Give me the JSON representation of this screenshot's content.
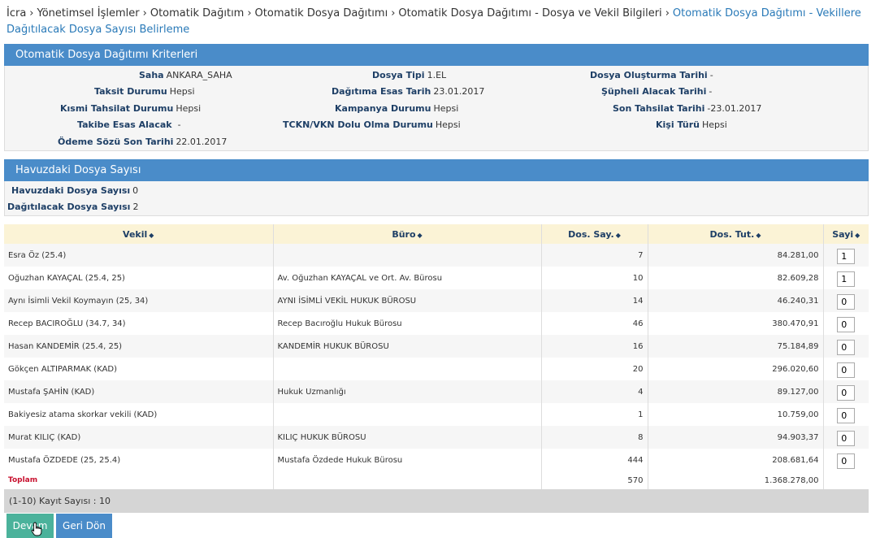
{
  "breadcrumb": {
    "items": [
      "İcra",
      "Yönetimsel İşlemler",
      "Otomatik Dağıtım",
      "Otomatik Dosya Dağıtımı",
      "Otomatik Dosya Dağıtımı - Dosya ve Vekil Bilgileri"
    ],
    "current": "Otomatik Dosya Dağıtımı - Vekillere Dağıtılacak Dosya Sayısı Belirleme",
    "separator": "›"
  },
  "criteria": {
    "title": "Otomatik Dosya Dağıtımı Kriterleri",
    "fields": {
      "saha": {
        "label": "Saha",
        "value": "ANKARA_SAHA"
      },
      "dosya_tipi": {
        "label": "Dosya Tipi",
        "value": "1.EL"
      },
      "dosya_olusturma_tarihi": {
        "label": "Dosya Oluşturma Tarihi",
        "value": "-"
      },
      "taksit_durumu": {
        "label": "Taksit Durumu",
        "value": "Hepsi"
      },
      "dagitima_esas_tarih": {
        "label": "Dağıtıma Esas Tarih",
        "value": "23.01.2017"
      },
      "supheli_alacak_tarihi": {
        "label": "Şüpheli Alacak Tarihi",
        "value": "-"
      },
      "kismi_tahsilat_durumu": {
        "label": "Kısmi Tahsilat Durumu",
        "value": "Hepsi"
      },
      "kampanya_durumu": {
        "label": "Kampanya Durumu",
        "value": "Hepsi"
      },
      "son_tahsilat_tarihi": {
        "label": "Son Tahsilat Tarihi",
        "value": "-23.01.2017"
      },
      "takibe_esas_alacak": {
        "label": "Takibe Esas Alacak",
        "value": "-"
      },
      "tckn_vkn": {
        "label": "TCKN/VKN Dolu Olma Durumu",
        "value": "Hepsi"
      },
      "kisi_turu": {
        "label": "Kişi Türü",
        "value": "Hepsi"
      },
      "odeme_sozu_son_tarihi": {
        "label": "Ödeme Sözü Son Tarihi",
        "value": "22.01.2017"
      }
    }
  },
  "pool": {
    "title": "Havuzdaki Dosya Sayısı",
    "havuzdaki": {
      "label": "Havuzdaki Dosya Sayısı",
      "value": "0"
    },
    "dagitilacak": {
      "label": "Dağıtılacak Dosya Sayısı",
      "value": "2"
    }
  },
  "table": {
    "columns": [
      "Vekil",
      "Büro",
      "Dos. Say.",
      "Dos. Tut.",
      "Sayi"
    ],
    "rows": [
      {
        "vekil": "Esra Öz (25.4)",
        "buro": "",
        "dos_say": "7",
        "dos_tut": "84.281,00",
        "sayi": "1"
      },
      {
        "vekil": "Oğuzhan KAYAÇAL (25.4, 25)",
        "buro": "Av. Oğuzhan KAYAÇAL  ve Ort. Av. Bürosu",
        "dos_say": "10",
        "dos_tut": "82.609,28",
        "sayi": "1"
      },
      {
        "vekil": "Aynı İsimli Vekil Koymayın (25, 34)",
        "buro": "AYNI İSİMLİ VEKİL HUKUK BÜROSU",
        "dos_say": "14",
        "dos_tut": "46.240,31",
        "sayi": "0"
      },
      {
        "vekil": "Recep BACIROĞLU (34.7, 34)",
        "buro": "Recep Bacıroğlu Hukuk Bürosu",
        "dos_say": "46",
        "dos_tut": "380.470,91",
        "sayi": "0"
      },
      {
        "vekil": "Hasan  KANDEMİR  (25.4, 25)",
        "buro": "KANDEMİR HUKUK BÜROSU",
        "dos_say": "16",
        "dos_tut": "75.184,89",
        "sayi": "0"
      },
      {
        "vekil": "Gökçen ALTIPARMAK (KAD)",
        "buro": "",
        "dos_say": "20",
        "dos_tut": "296.020,60",
        "sayi": "0"
      },
      {
        "vekil": "Mustafa ŞAHİN (KAD)",
        "buro": "Hukuk Uzmanlığı",
        "dos_say": "4",
        "dos_tut": "89.127,00",
        "sayi": "0"
      },
      {
        "vekil": "Bakiyesiz atama skorkar vekili (KAD)",
        "buro": "",
        "dos_say": "1",
        "dos_tut": "10.759,00",
        "sayi": "0"
      },
      {
        "vekil": "Murat KILIÇ (KAD)",
        "buro": "KILIÇ HUKUK BÜROSU",
        "dos_say": "8",
        "dos_tut": "94.903,37",
        "sayi": "0"
      },
      {
        "vekil": "Mustafa ÖZDEDE (25, 25.4)",
        "buro": "Mustafa Özdede Hukuk Bürosu",
        "dos_say": "444",
        "dos_tut": "208.681,64",
        "sayi": "0"
      }
    ],
    "total": {
      "label": "Toplam",
      "dos_say": "570",
      "dos_tut": "1.368.278,00"
    }
  },
  "footer": {
    "record_info": "(1-10) Kayıt Sayısı : 10"
  },
  "buttons": {
    "devam": "Devam",
    "geri_don": "Geri Dön"
  },
  "colors": {
    "header_blue": "#4a8cc9",
    "devam_green": "#4bb29b",
    "total_red": "#c8102e",
    "link_blue": "#2a7ab8"
  },
  "icons": {
    "sort": "sort-icon",
    "cursor": "hand-pointer-icon"
  }
}
